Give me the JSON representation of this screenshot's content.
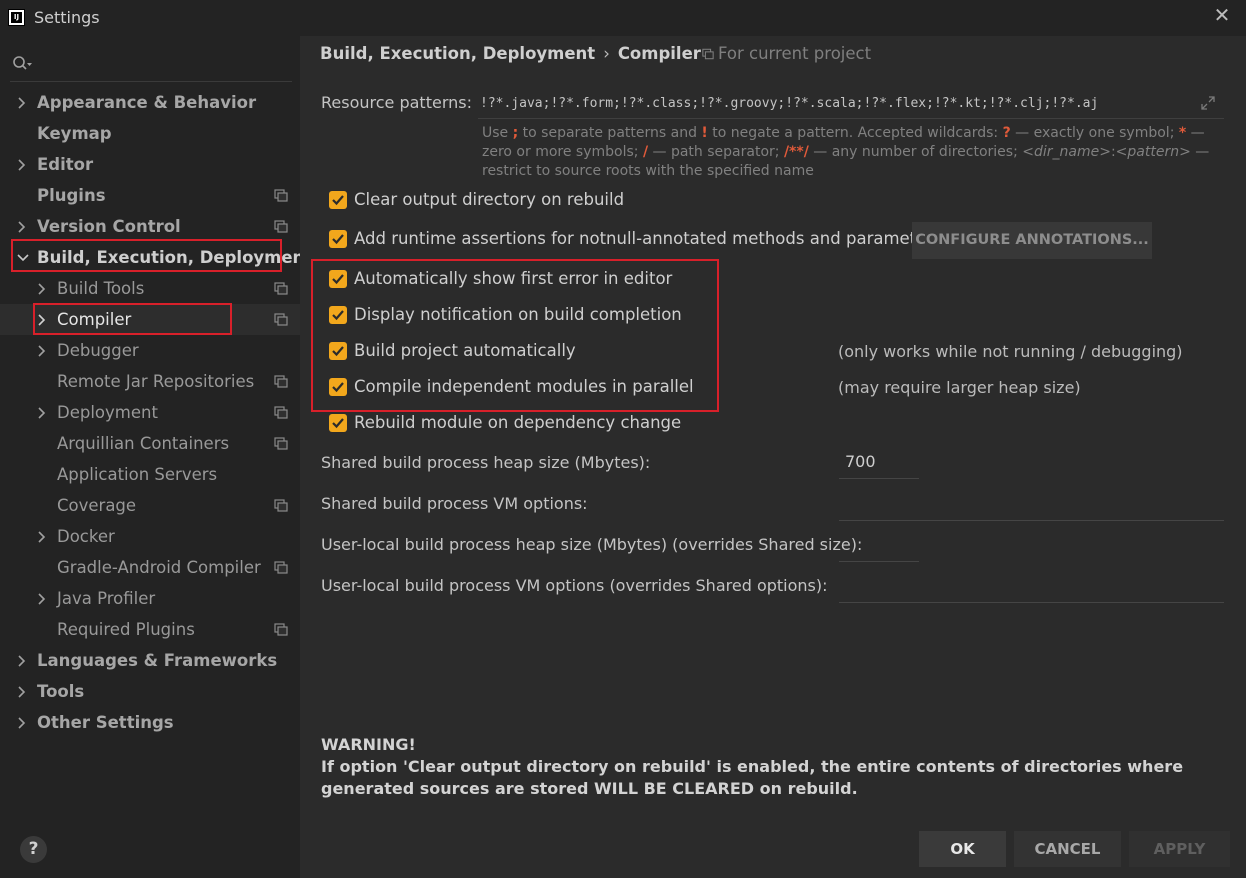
{
  "window": {
    "title": "Settings",
    "close_glyph": "✕",
    "app_icon_text": "IJ"
  },
  "sidebar": {
    "search_placeholder": "",
    "items": [
      {
        "label": "Appearance & Behavior"
      },
      {
        "label": "Keymap"
      },
      {
        "label": "Editor"
      },
      {
        "label": "Plugins"
      },
      {
        "label": "Version Control"
      },
      {
        "label": "Build, Execution, Deployment"
      },
      {
        "label": "Build Tools"
      },
      {
        "label": "Compiler"
      },
      {
        "label": "Debugger"
      },
      {
        "label": "Remote Jar Repositories"
      },
      {
        "label": "Deployment"
      },
      {
        "label": "Arquillian Containers"
      },
      {
        "label": "Application Servers"
      },
      {
        "label": "Coverage"
      },
      {
        "label": "Docker"
      },
      {
        "label": "Gradle-Android Compiler"
      },
      {
        "label": "Java Profiler"
      },
      {
        "label": "Required Plugins"
      },
      {
        "label": "Languages & Frameworks"
      },
      {
        "label": "Tools"
      },
      {
        "label": "Other Settings"
      }
    ],
    "help_label": "?"
  },
  "breadcrumb": {
    "parent": "Build, Execution, Deployment",
    "separator": "›",
    "current": "Compiler",
    "scope": "For current project"
  },
  "resource_patterns": {
    "label": "Resource patterns:",
    "value": "!?*.java;!?*.form;!?*.class;!?*.groovy;!?*.scala;!?*.flex;!?*.kt;!?*.clj;!?*.aj",
    "hint": {
      "t1": "Use ",
      "h1": ";",
      "t2": " to separate patterns and ",
      "h2": "!",
      "t3": " to negate a pattern. Accepted wildcards: ",
      "h3": "?",
      "t4": " — exactly one symbol; ",
      "h4": "*",
      "t5": " — zero or more symbols; ",
      "h5": "/",
      "t6": " — path separator; ",
      "h6": "/**/",
      "t7": " — any number of directories; ",
      "i1": "<dir_name>",
      "t8": ":",
      "i2": "<pattern>",
      "t9": " — restrict to source roots with the specified name"
    }
  },
  "options": {
    "clear_output": "Clear output directory on rebuild",
    "runtime_assertions": "Add runtime assertions for notnull-annotated methods and parameters",
    "configure_annotations": "CONFIGURE ANNOTATIONS...",
    "show_first_error": "Automatically show first error in editor",
    "display_notification": "Display notification on build completion",
    "build_automatically": "Build project automatically",
    "build_automatically_note": "(only works while not running / debugging)",
    "compile_parallel": "Compile independent modules in parallel",
    "compile_parallel_note": "(may require larger heap size)",
    "rebuild_on_dependency": "Rebuild module on dependency change"
  },
  "fields": {
    "shared_heap_label": "Shared build process heap size (Mbytes):",
    "shared_heap_value": "700",
    "shared_vm_label": "Shared build process VM options:",
    "shared_vm_value": "",
    "local_heap_label": "User-local build process heap size (Mbytes) (overrides Shared size):",
    "local_heap_value": "",
    "local_vm_label": "User-local build process VM options (overrides Shared options):",
    "local_vm_value": ""
  },
  "warning": {
    "title": "WARNING!",
    "text": "If option 'Clear output directory on rebuild' is enabled, the entire contents of directories where generated sources are stored WILL BE CLEARED on rebuild."
  },
  "buttons": {
    "ok": "OK",
    "cancel": "CANCEL",
    "apply": "APPLY"
  },
  "colors": {
    "checkbox": "#f2a71c",
    "highlight_box": "#d8202a",
    "hint_accent": "#e05a3a"
  }
}
